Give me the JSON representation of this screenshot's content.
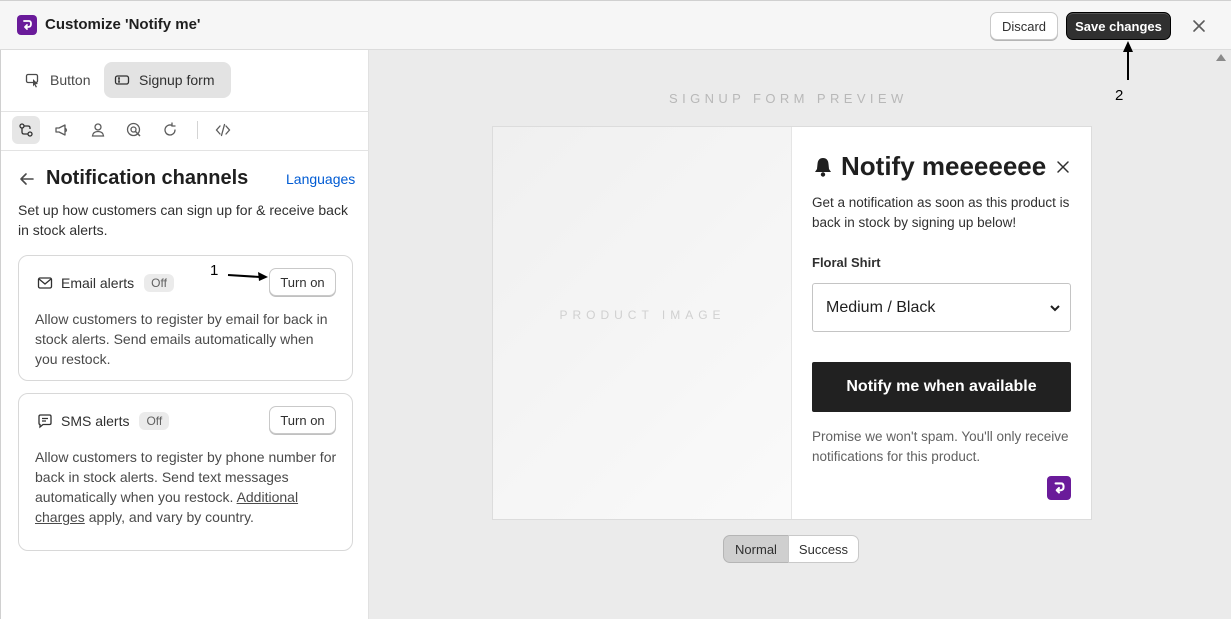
{
  "header": {
    "title": "Customize 'Notify me'",
    "discard_label": "Discard",
    "save_label": "Save changes"
  },
  "sidebar": {
    "mode_tabs": [
      {
        "label": "Button",
        "icon": "cursor-click-icon",
        "active": false
      },
      {
        "label": "Signup form",
        "icon": "form-icon",
        "active": true
      }
    ],
    "toolbar_icons": [
      "channels-icon",
      "megaphone-icon",
      "person-icon",
      "target-icon",
      "refresh-icon",
      "code-icon"
    ],
    "section": {
      "title": "Notification channels",
      "languages_link": "Languages",
      "description": "Set up how customers can sign up for & receive back in stock alerts."
    },
    "channels": [
      {
        "label": "Email alerts",
        "status": "Off",
        "action": "Turn on",
        "description": "Allow customers to register by email for back in stock alerts. Send emails automatically when you restock."
      },
      {
        "label": "SMS alerts",
        "status": "Off",
        "action": "Turn on",
        "description_start": "Allow customers to register by phone number for back in stock alerts. Send text messages automatically when you restock.",
        "description_link": "Additional charges",
        "description_end": "apply, and vary by country."
      }
    ]
  },
  "preview": {
    "label": "SIGNUP FORM PREVIEW",
    "product_image_label": "PRODUCT IMAGE",
    "form": {
      "title": "Notify meeeeeee",
      "description": "Get a notification as soon as this product is back in stock by signing up below!",
      "product_name": "Floral Shirt",
      "variant_selected": "Medium / Black",
      "submit_label": "Notify me when available",
      "note": "Promise we won't spam. You'll only receive notifications for this product."
    },
    "states": [
      {
        "label": "Normal",
        "active": true
      },
      {
        "label": "Success",
        "active": false
      }
    ]
  },
  "annotations": {
    "marker_1": "1",
    "marker_2": "2"
  },
  "colors": {
    "brand": "#6a1b9a",
    "primary_button": "#303030",
    "link": "#005bd3",
    "submit_button": "#212121"
  }
}
